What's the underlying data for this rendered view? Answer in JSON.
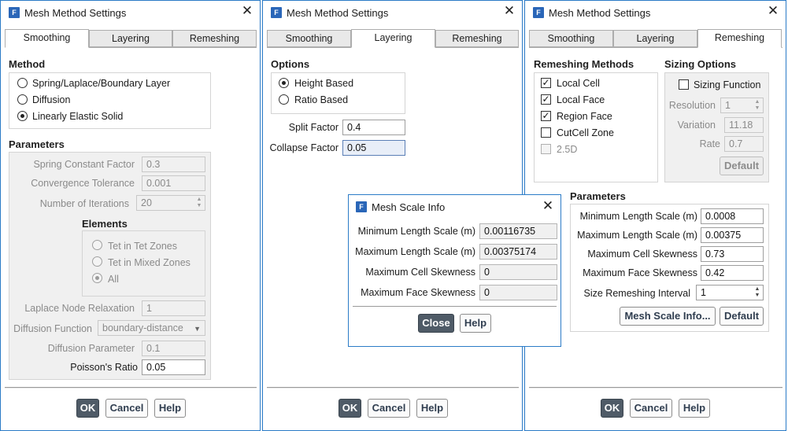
{
  "dialog_title": "Mesh Method Settings",
  "app_icon": "F",
  "tabs": [
    "Smoothing",
    "Layering",
    "Remeshing"
  ],
  "buttons": {
    "ok": "OK",
    "cancel": "Cancel",
    "help": "Help"
  },
  "smoothing": {
    "method_heading": "Method",
    "methods": [
      {
        "label": "Spring/Laplace/Boundary Layer",
        "selected": false
      },
      {
        "label": "Diffusion",
        "selected": false
      },
      {
        "label": "Linearly Elastic Solid",
        "selected": true
      }
    ],
    "parameters_heading": "Parameters",
    "spring_constant_label": "Spring Constant Factor",
    "spring_constant_value": "0.3",
    "convergence_label": "Convergence Tolerance",
    "convergence_value": "0.001",
    "iterations_label": "Number of Iterations",
    "iterations_value": "20",
    "elements_heading": "Elements",
    "elements": [
      {
        "label": "Tet in Tet Zones",
        "selected": false
      },
      {
        "label": "Tet in Mixed Zones",
        "selected": false
      },
      {
        "label": "All",
        "selected": true
      }
    ],
    "laplace_label": "Laplace Node Relaxation",
    "laplace_value": "1",
    "diffusion_function_label": "Diffusion Function",
    "diffusion_function_value": "boundary-distance",
    "diffusion_parameter_label": "Diffusion Parameter",
    "diffusion_parameter_value": "0.1",
    "poisson_label": "Poisson's Ratio",
    "poisson_value": "0.05"
  },
  "layering": {
    "options_heading": "Options",
    "options": [
      {
        "label": "Height Based",
        "selected": true
      },
      {
        "label": "Ratio Based",
        "selected": false
      }
    ],
    "split_factor_label": "Split Factor",
    "split_factor_value": "0.4",
    "collapse_factor_label": "Collapse Factor",
    "collapse_factor_value": "0.05"
  },
  "remeshing": {
    "methods_heading": "Remeshing Methods",
    "methods": [
      {
        "label": "Local Cell",
        "checked": true,
        "enabled": true
      },
      {
        "label": "Local Face",
        "checked": true,
        "enabled": true
      },
      {
        "label": "Region Face",
        "checked": true,
        "enabled": true
      },
      {
        "label": "CutCell Zone",
        "checked": false,
        "enabled": true
      },
      {
        "label": "2.5D",
        "checked": false,
        "enabled": false
      }
    ],
    "sizing_heading": "Sizing Options",
    "sizing_function_label": "Sizing Function",
    "sizing_function_checked": false,
    "resolution_label": "Resolution",
    "resolution_value": "1",
    "variation_label": "Variation",
    "variation_value": "11.18",
    "rate_label": "Rate",
    "rate_value": "0.7",
    "sizing_default_label": "Default",
    "parameters_heading": "Parameters",
    "min_length_label": "Minimum Length Scale (m)",
    "min_length_value": "0.0008",
    "max_length_label": "Maximum Length Scale (m)",
    "max_length_value": "0.00375",
    "max_cell_skew_label": "Maximum Cell Skewness",
    "max_cell_skew_value": "0.73",
    "max_face_skew_label": "Maximum Face Skewness",
    "max_face_skew_value": "0.42",
    "interval_label": "Size Remeshing Interval",
    "interval_value": "1",
    "mesh_scale_info_label": "Mesh Scale Info...",
    "default_label": "Default"
  },
  "mesh_scale_info": {
    "title": "Mesh Scale Info",
    "min_length_label": "Minimum Length Scale (m)",
    "min_length_value": "0.00116735",
    "max_length_label": "Maximum Length Scale (m)",
    "max_length_value": "0.00375174",
    "max_cell_skew_label": "Maximum Cell Skewness",
    "max_cell_skew_value": "0",
    "max_face_skew_label": "Maximum Face Skewness",
    "max_face_skew_value": "0",
    "close_label": "Close",
    "help_label": "Help"
  }
}
